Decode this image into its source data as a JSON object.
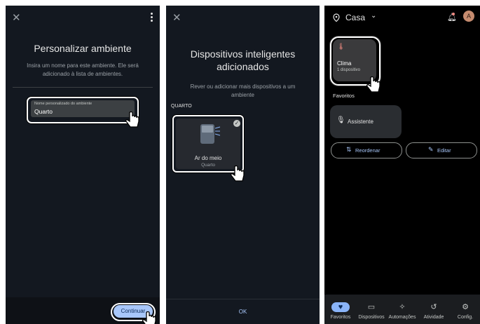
{
  "panel1": {
    "title": "Personalizar ambiente",
    "description": "Insira um nome para este ambiente. Ele será adicionado à lista de ambientes.",
    "field": {
      "label": "Nome personalizado do ambiente",
      "value": "Quarto"
    },
    "continue_label": "Continuar"
  },
  "panel2": {
    "title": "Dispositivos inteligentes adicionados",
    "subtitle": "Rever ou adicionar mais dispositivos a um ambiente",
    "section": "QUARTO",
    "device": {
      "name": "Ar do meio",
      "room": "Quarto"
    },
    "ok_label": "OK"
  },
  "panel3": {
    "home": "Casa",
    "avatar_letter": "A",
    "clima": {
      "title": "Clima",
      "subtitle": "1 dispositivo"
    },
    "favorites_label": "Favoritos",
    "assistant_label": "Assistente",
    "reorder_label": "Reordenar",
    "edit_label": "Editar",
    "nav": [
      {
        "label": "Favoritos",
        "icon": "heart-icon"
      },
      {
        "label": "Dispositivos",
        "icon": "devices-icon"
      },
      {
        "label": "Automações",
        "icon": "sparkle-icon"
      },
      {
        "label": "Atividade",
        "icon": "history-icon"
      },
      {
        "label": "Config.",
        "icon": "gear-icon"
      }
    ]
  },
  "colors": {
    "accent": "#a8c7fa",
    "card": "#3a3a3c",
    "active_pill": "#8ab4f8"
  }
}
